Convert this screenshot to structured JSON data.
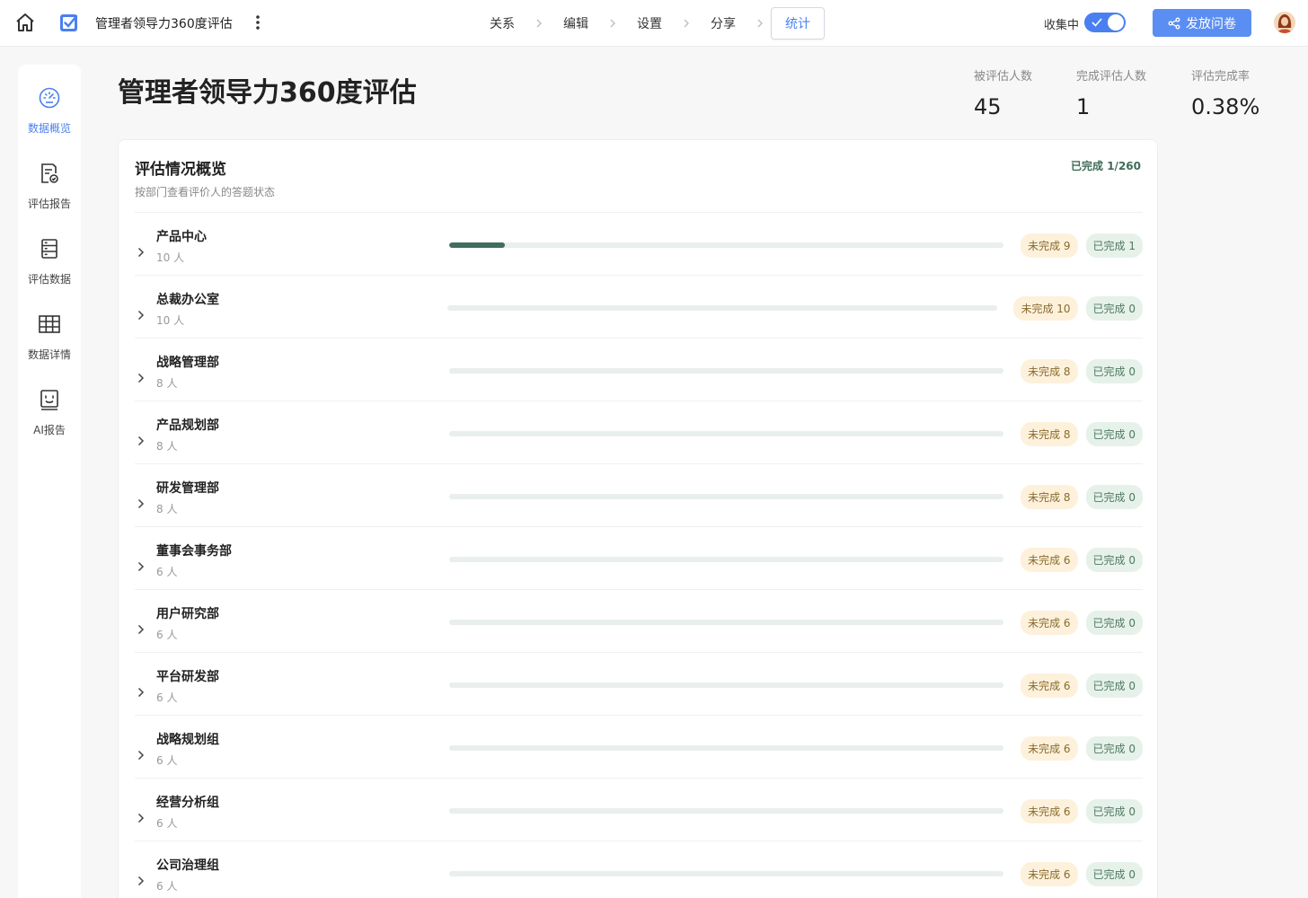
{
  "header": {
    "app_title": "管理者领导力360度评估",
    "steps": [
      {
        "label": "关系",
        "active": false
      },
      {
        "label": "编辑",
        "active": false
      },
      {
        "label": "设置",
        "active": false
      },
      {
        "label": "分享",
        "active": false
      },
      {
        "label": "统计",
        "active": true
      }
    ],
    "collect_label": "收集中",
    "collect_on": true,
    "publish_label": "发放问卷"
  },
  "sidebar": {
    "items": [
      {
        "label": "数据概览",
        "icon": "dashboard-icon",
        "active": true
      },
      {
        "label": "评估报告",
        "icon": "report-icon",
        "active": false
      },
      {
        "label": "评估数据",
        "icon": "database-icon",
        "active": false
      },
      {
        "label": "数据详情",
        "icon": "table-grid-icon",
        "active": false
      },
      {
        "label": "AI报告",
        "icon": "ai-face-icon",
        "active": false
      }
    ]
  },
  "page": {
    "title": "管理者领导力360度评估",
    "stats": [
      {
        "label": "被评估人数",
        "value": "45"
      },
      {
        "label": "完成评估人数",
        "value": "1"
      },
      {
        "label": "评估完成率",
        "value": "0.38%"
      }
    ]
  },
  "overview": {
    "title": "评估情况概览",
    "subtitle": "按部门查看评价人的答题状态",
    "done_summary": "已完成 1/260",
    "departments": [
      {
        "name": "产品中心",
        "count": "10 人",
        "pending": "未完成 9",
        "done": "已完成 1",
        "progress": 0.1
      },
      {
        "name": "总裁办公室",
        "count": "10 人",
        "pending": "未完成 10",
        "done": "已完成 0",
        "progress": 0
      },
      {
        "name": "战略管理部",
        "count": "8 人",
        "pending": "未完成 8",
        "done": "已完成 0",
        "progress": 0
      },
      {
        "name": "产品规划部",
        "count": "8 人",
        "pending": "未完成 8",
        "done": "已完成 0",
        "progress": 0
      },
      {
        "name": "研发管理部",
        "count": "8 人",
        "pending": "未完成 8",
        "done": "已完成 0",
        "progress": 0
      },
      {
        "name": "董事会事务部",
        "count": "6 人",
        "pending": "未完成 6",
        "done": "已完成 0",
        "progress": 0
      },
      {
        "name": "用户研究部",
        "count": "6 人",
        "pending": "未完成 6",
        "done": "已完成 0",
        "progress": 0
      },
      {
        "name": "平台研发部",
        "count": "6 人",
        "pending": "未完成 6",
        "done": "已完成 0",
        "progress": 0
      },
      {
        "name": "战略规划组",
        "count": "6 人",
        "pending": "未完成 6",
        "done": "已完成 0",
        "progress": 0
      },
      {
        "name": "经营分析组",
        "count": "6 人",
        "pending": "未完成 6",
        "done": "已完成 0",
        "progress": 0
      },
      {
        "name": "公司治理组",
        "count": "6 人",
        "pending": "未完成 6",
        "done": "已完成 0",
        "progress": 0
      }
    ]
  },
  "colors": {
    "accent": "#4a7ff0",
    "progress": "#3f6f5c",
    "pending_bg": "#fdf1dc",
    "done_bg": "#e6f1ea"
  }
}
